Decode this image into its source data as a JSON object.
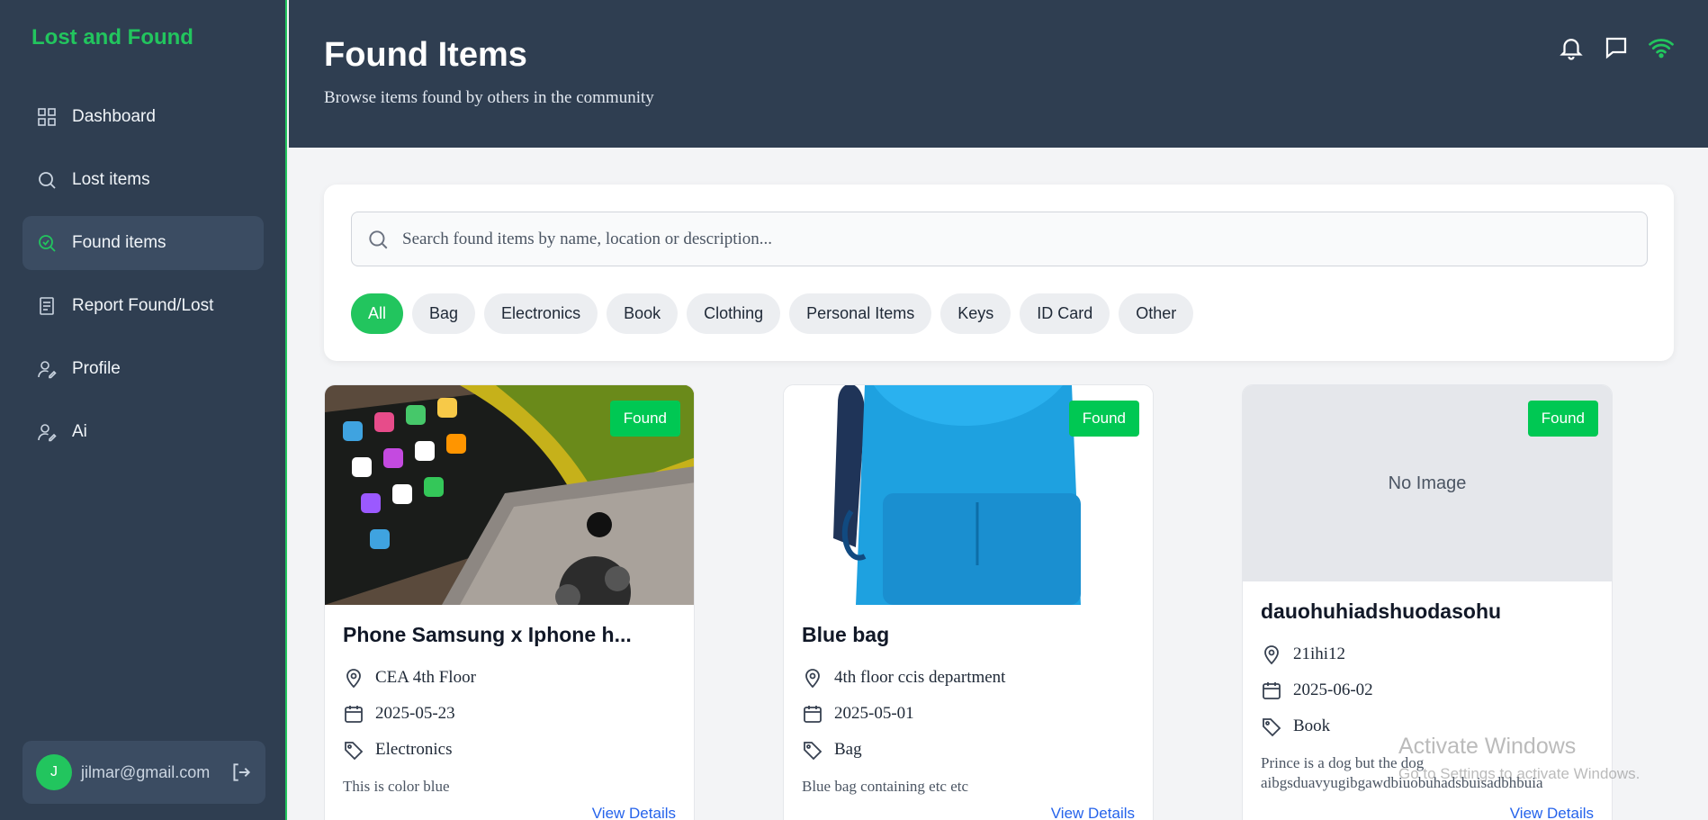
{
  "brand": "Lost and Found",
  "sidebar": {
    "items": [
      {
        "label": "Dashboard",
        "icon": "grid-icon"
      },
      {
        "label": "Lost items",
        "icon": "search-icon"
      },
      {
        "label": "Found items",
        "icon": "search-check-icon"
      },
      {
        "label": "Report Found/Lost",
        "icon": "document-icon"
      },
      {
        "label": "Profile",
        "icon": "user-edit-icon"
      },
      {
        "label": "Ai",
        "icon": "user-edit-icon"
      }
    ],
    "active_index": 2
  },
  "user": {
    "initial": "J",
    "email": "jilmar@gmail.com"
  },
  "header": {
    "title": "Found Items",
    "subtitle": "Browse items found by others in the community"
  },
  "search": {
    "placeholder": "Search found items by name, location or description..."
  },
  "filters": [
    "All",
    "Bag",
    "Electronics",
    "Book",
    "Clothing",
    "Personal Items",
    "Keys",
    "ID Card",
    "Other"
  ],
  "active_filter": "All",
  "cards": [
    {
      "badge": "Found",
      "title": "Phone Samsung x Iphone h...",
      "location": "CEA 4th Floor",
      "date": "2025-05-23",
      "category": "Electronics",
      "description": "This is color blue",
      "link": "View Details"
    },
    {
      "badge": "Found",
      "title": "Blue bag",
      "location": "4th floor ccis department",
      "date": "2025-05-01",
      "category": "Bag",
      "description": "Blue bag containing etc etc",
      "link": "View Details"
    },
    {
      "badge": "Found",
      "no_image": "No Image",
      "title": "dauohuhiadshuodasohu",
      "location": "21ihi12",
      "date": "2025-06-02",
      "category": "Book",
      "description": "Prince is a dog but the dog\naibgsduavyugibgawdbiuobuhadsbuisadbhbuia",
      "link": "View Details"
    }
  ],
  "watermark": {
    "line1": "Activate Windows",
    "line2": "Go to Settings to activate Windows."
  },
  "colors": {
    "accent": "#22c55e",
    "sidebar_bg": "#2f3e51",
    "badge": "#00c853",
    "link": "#2563eb"
  }
}
